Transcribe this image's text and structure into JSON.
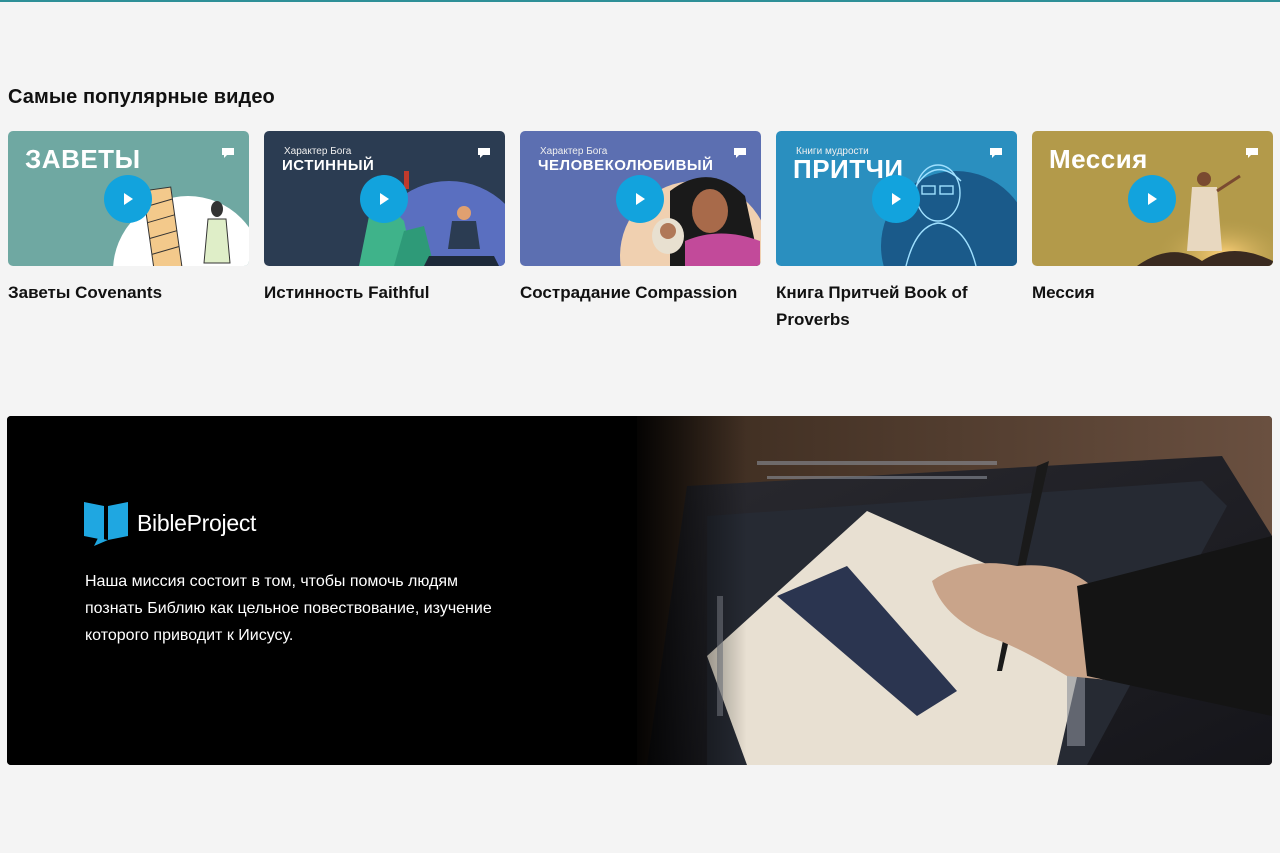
{
  "section": {
    "title": "Самые популярные видео"
  },
  "videos": [
    {
      "thumb_kicker": "",
      "thumb_title": "ЗАВЕТЫ",
      "title": "Заветы Covenants",
      "color": "#6fa8a2",
      "icon": "play-icon"
    },
    {
      "thumb_kicker": "Характер Бога",
      "thumb_title": "ИСТИННЫЙ",
      "title": "Истинность Faithful",
      "color": "#2b3c52",
      "icon": "play-icon"
    },
    {
      "thumb_kicker": "Характер Бога",
      "thumb_title": "ЧЕЛОВЕКОЛЮБИВЫЙ",
      "title": "Сострадание Compassion",
      "color": "#5c6fb1",
      "icon": "play-icon"
    },
    {
      "thumb_kicker": "Книги мудрости",
      "thumb_title": "ПРИТЧИ",
      "title": "Книга Притчей Book of Proverbs",
      "color": "#2a8fbf",
      "icon": "play-icon"
    },
    {
      "thumb_kicker": "",
      "thumb_title": "Мессия",
      "title": "Мессия",
      "color": "#b39a4a",
      "icon": "play-icon"
    }
  ],
  "banner": {
    "brand_name": "BibleProject",
    "mission": "Наша миссия состоит в том, чтобы помочь людям познать Библию как цельное повествование, изучение которого приводит к Иисусу.",
    "logo_icon": "bible-project-book-icon",
    "logo_color": "#1fa7e1"
  },
  "colors": {
    "play_button": "#12a3dd",
    "background": "#f4f4f4"
  }
}
